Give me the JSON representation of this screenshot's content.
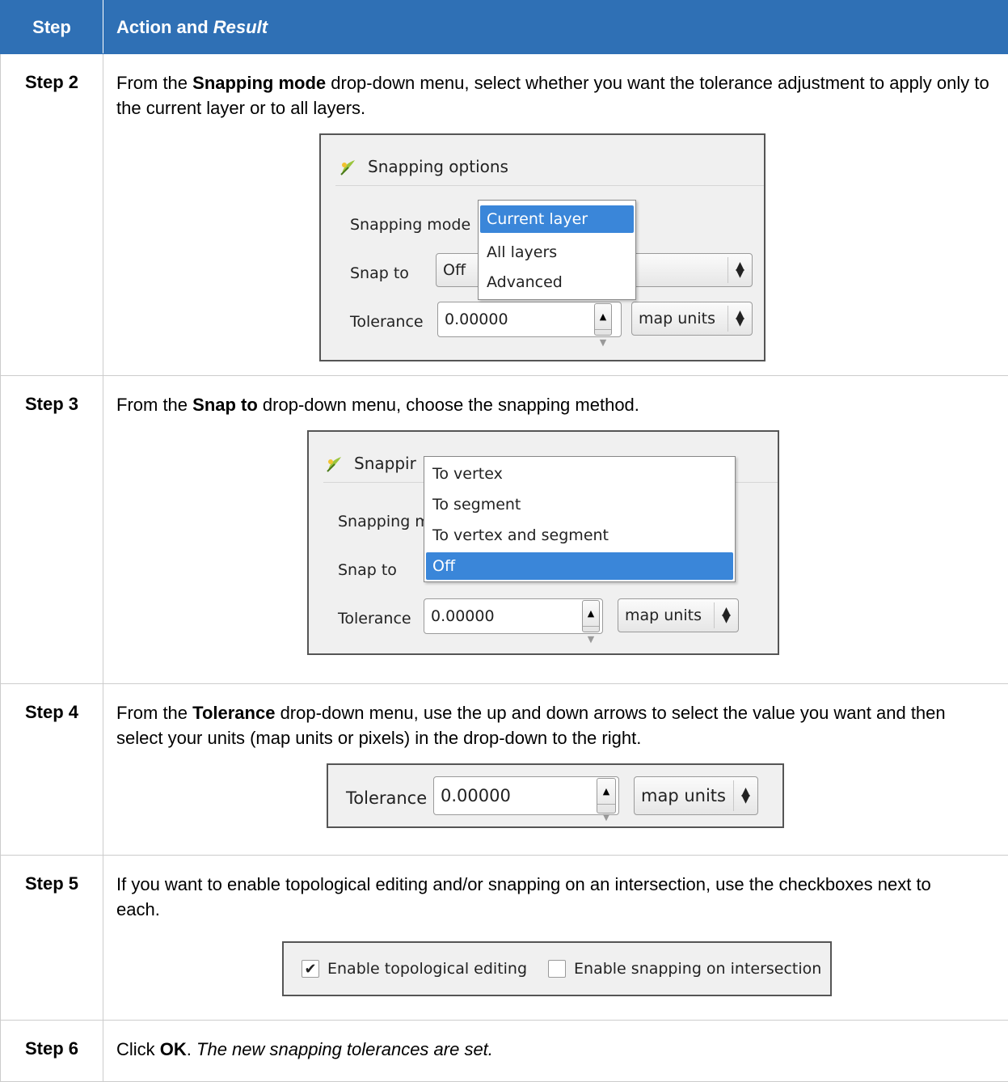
{
  "header": {
    "step": "Step",
    "action_plain": "Action and ",
    "action_italic": "Result"
  },
  "step2": {
    "label": "Step 2",
    "t1": "From the ",
    "k1": "Snapping mode",
    "t2": " drop-down menu, select whether you want the tolerance adjustment to apply only to the current layer or to all layers.",
    "shot": {
      "title": "Snapping options",
      "mode_label": "Snapping mode",
      "snapto_label": "Snap to",
      "snapto_value": "Off",
      "tolerance_label": "Tolerance",
      "tolerance_value": "0.00000",
      "units_value": "map units",
      "options": [
        "Current layer",
        "All layers",
        "Advanced"
      ],
      "selected_index": 0
    }
  },
  "step3": {
    "label": "Step 3",
    "t1": "From the ",
    "k1": "Snap to",
    "t2": " drop-down menu, choose the snapping method.",
    "shot": {
      "title": "Snappir",
      "mode_label": "Snapping m",
      "snapto_label": "Snap to",
      "tolerance_label": "Tolerance",
      "tolerance_value": "0.00000",
      "units_value": "map units",
      "options": [
        "To vertex",
        "To segment",
        "To vertex and segment",
        "Off"
      ],
      "selected_index": 3
    }
  },
  "step4": {
    "label": "Step 4",
    "t1": "From the ",
    "k1": "Tolerance",
    "t2": " drop-down menu, use the up and down arrows to select the value you want and then select your units (map units or pixels) in the drop-down to the right.",
    "shot": {
      "tolerance_label": "Tolerance",
      "tolerance_value": "0.00000",
      "units_value": "map units"
    }
  },
  "step5": {
    "label": "Step 5",
    "t1": "If you want to enable topological editing and/or snapping on an intersection, use the checkboxes next to each.",
    "shot": {
      "cb1_label": "Enable topological editing",
      "cb1_checked": true,
      "cb2_label": "Enable snapping on intersection",
      "cb2_checked": false
    }
  },
  "step6": {
    "label": "Step 6",
    "t1": "Click ",
    "k1": "OK",
    "t2": ". ",
    "r1": "The new snapping tolerances are set."
  },
  "icons": {
    "leaf": "qgis-snapping-icon",
    "check": "checkmark-icon"
  },
  "colors": {
    "header_bg": "#2f70b5",
    "selection": "#3a86d9"
  }
}
